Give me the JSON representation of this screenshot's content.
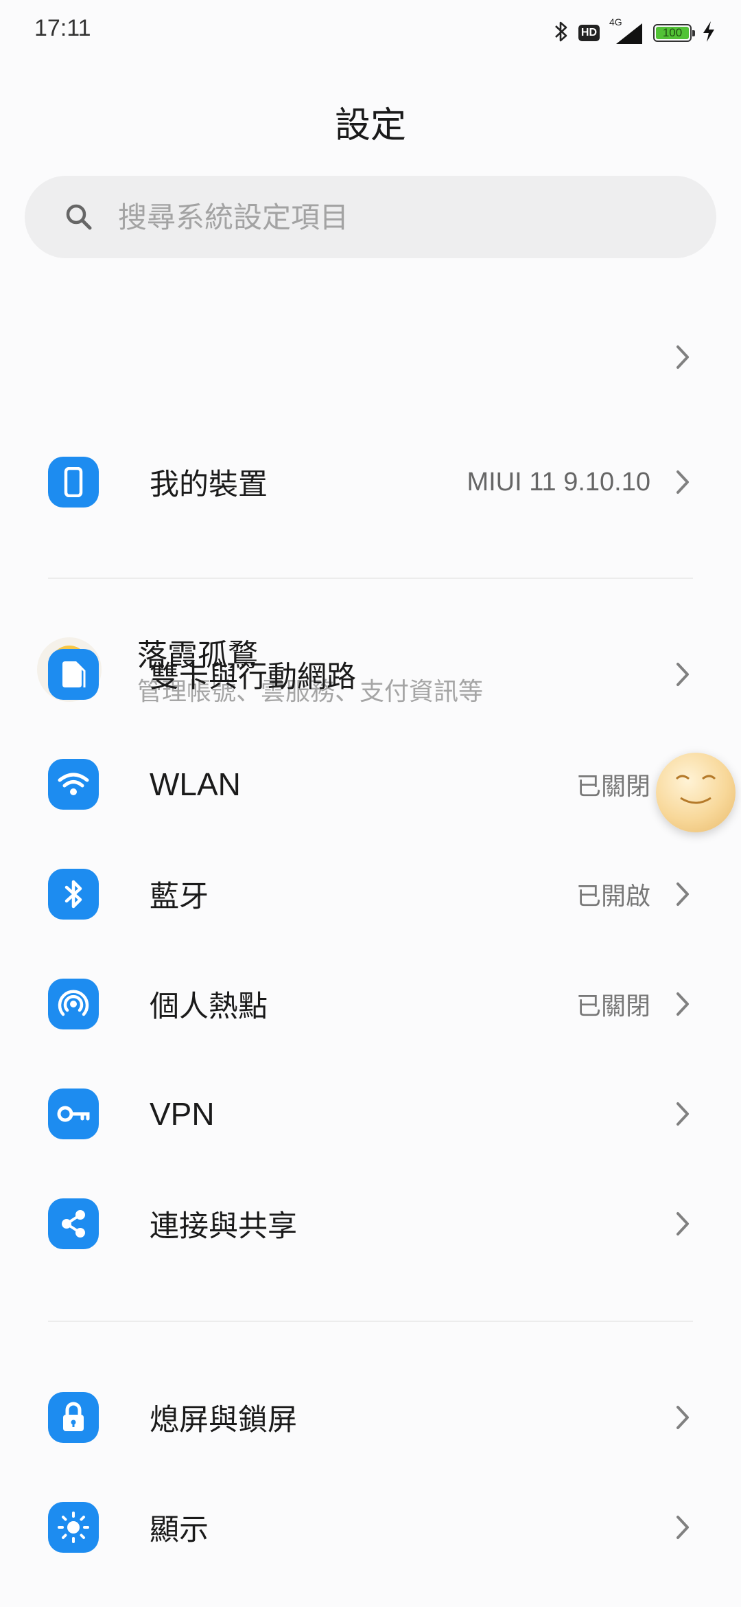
{
  "status_bar": {
    "time": "17:11",
    "network": "4G",
    "hd": "HD",
    "battery": "100"
  },
  "page": {
    "title": "設定"
  },
  "search": {
    "placeholder": "搜尋系統設定項目"
  },
  "account": {
    "name": "落霞孤鶩",
    "subtitle": "管理帳號、雲服務、支付資訊等"
  },
  "items": [
    {
      "label": "我的裝置",
      "value": "MIUI 11 9.10.10",
      "icon": "phone-icon"
    },
    {
      "label": "雙卡與行動網路",
      "value": "",
      "icon": "sim-card-icon"
    },
    {
      "label": "WLAN",
      "value": "已關閉",
      "icon": "wifi-icon"
    },
    {
      "label": "藍牙",
      "value": "已開啟",
      "icon": "bluetooth-icon"
    },
    {
      "label": "個人熱點",
      "value": "已關閉",
      "icon": "hotspot-icon"
    },
    {
      "label": "VPN",
      "value": "",
      "icon": "key-icon"
    },
    {
      "label": "連接與共享",
      "value": "",
      "icon": "share-icon"
    },
    {
      "label": "熄屏與鎖屏",
      "value": "",
      "icon": "lock-icon"
    },
    {
      "label": "顯示",
      "value": "",
      "icon": "brightness-icon"
    }
  ],
  "colors": {
    "accent": "#1d8cf0",
    "battery": "#52c236"
  }
}
